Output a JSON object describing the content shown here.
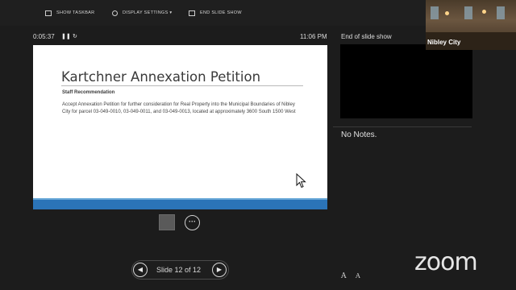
{
  "toolbar": {
    "show_taskbar": "SHOW TASKBAR",
    "display_settings": "DISPLAY SETTINGS ▾",
    "end_slide_show": "END SLIDE SHOW"
  },
  "presenter": {
    "timer": "0:05:37",
    "pause_glyph": "❚❚",
    "reset_glyph": "↻",
    "clock": "11:06 PM",
    "next_slide_title": "End of slide show",
    "notes_text": "No Notes."
  },
  "slide": {
    "title": "Kartchner Annexation Petition",
    "subtitle": "Staff Recommendation",
    "body": "Accept Annexation Petition for further consideration for Real Property into the Municipal Boundaries of Nibley City for parcel 03-049-0010, 03-049-0011, and 03-049-0013, located at approximately 3600 South 1500 West"
  },
  "tools": {
    "more_glyph": "···"
  },
  "navigator": {
    "prev_glyph": "◀",
    "next_glyph": "▶",
    "label": "Slide 12 of 12"
  },
  "font_controls": {
    "increase": "A",
    "decrease": "A"
  },
  "video": {
    "participant_name": "Nibley City"
  },
  "branding": {
    "logo_text": "zoom"
  },
  "colors": {
    "slide_accent": "#2b74b8",
    "background": "#1c1c1c"
  },
  "icons": [
    "taskbar-icon",
    "gear-icon",
    "end-show-icon",
    "pause-icon",
    "reset-icon",
    "pen-tool-icon",
    "more-options-icon",
    "prev-slide-icon",
    "next-slide-icon",
    "font-increase-icon",
    "font-decrease-icon",
    "mouse-cursor-icon"
  ]
}
